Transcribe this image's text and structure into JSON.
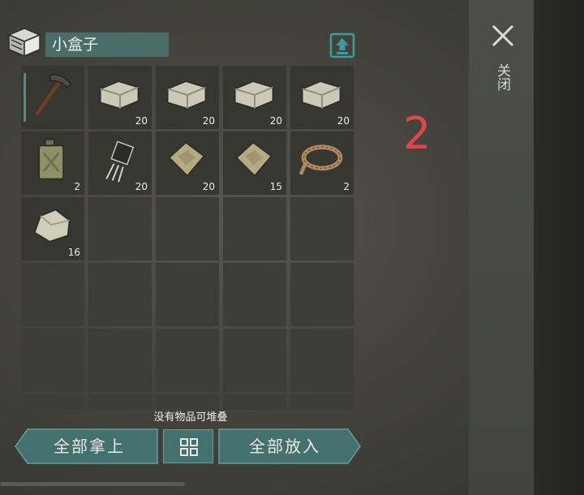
{
  "header": {
    "title": "小盒子",
    "box_icon": "storage-box-icon",
    "upload_icon": "upload-icon"
  },
  "close": {
    "label": "关闭",
    "icon": "close-icon"
  },
  "page_number": "2",
  "slots": [
    {
      "item": "pickaxe",
      "count": ""
    },
    {
      "item": "stone-block",
      "count": "20"
    },
    {
      "item": "stone-block",
      "count": "20"
    },
    {
      "item": "stone-block",
      "count": "20"
    },
    {
      "item": "stone-block",
      "count": "20"
    },
    {
      "item": "jerrycan",
      "count": "2"
    },
    {
      "item": "transistor",
      "count": "20"
    },
    {
      "item": "cloth-scrap",
      "count": "20"
    },
    {
      "item": "cloth-scrap",
      "count": "15"
    },
    {
      "item": "rope",
      "count": "2"
    },
    {
      "item": "stone",
      "count": "16"
    },
    {
      "item": "",
      "count": ""
    },
    {
      "item": "",
      "count": ""
    },
    {
      "item": "",
      "count": ""
    },
    {
      "item": "",
      "count": ""
    },
    {
      "item": "",
      "count": ""
    },
    {
      "item": "",
      "count": ""
    },
    {
      "item": "",
      "count": ""
    },
    {
      "item": "",
      "count": ""
    },
    {
      "item": "",
      "count": ""
    },
    {
      "item": "",
      "count": ""
    },
    {
      "item": "",
      "count": ""
    },
    {
      "item": "",
      "count": ""
    },
    {
      "item": "",
      "count": ""
    },
    {
      "item": "",
      "count": ""
    },
    {
      "item": "",
      "count": ""
    },
    {
      "item": "",
      "count": ""
    },
    {
      "item": "",
      "count": ""
    },
    {
      "item": "",
      "count": ""
    },
    {
      "item": "",
      "count": ""
    }
  ],
  "footer": {
    "stack_message": "没有物品可堆叠",
    "take_all_label": "全部拿上",
    "put_all_label": "全部放入",
    "sort_icon": "sort-grid-icon"
  },
  "colors": {
    "accent": "#4a6d6a",
    "slot_bg": "#373732",
    "page_number": "#e0454b"
  }
}
